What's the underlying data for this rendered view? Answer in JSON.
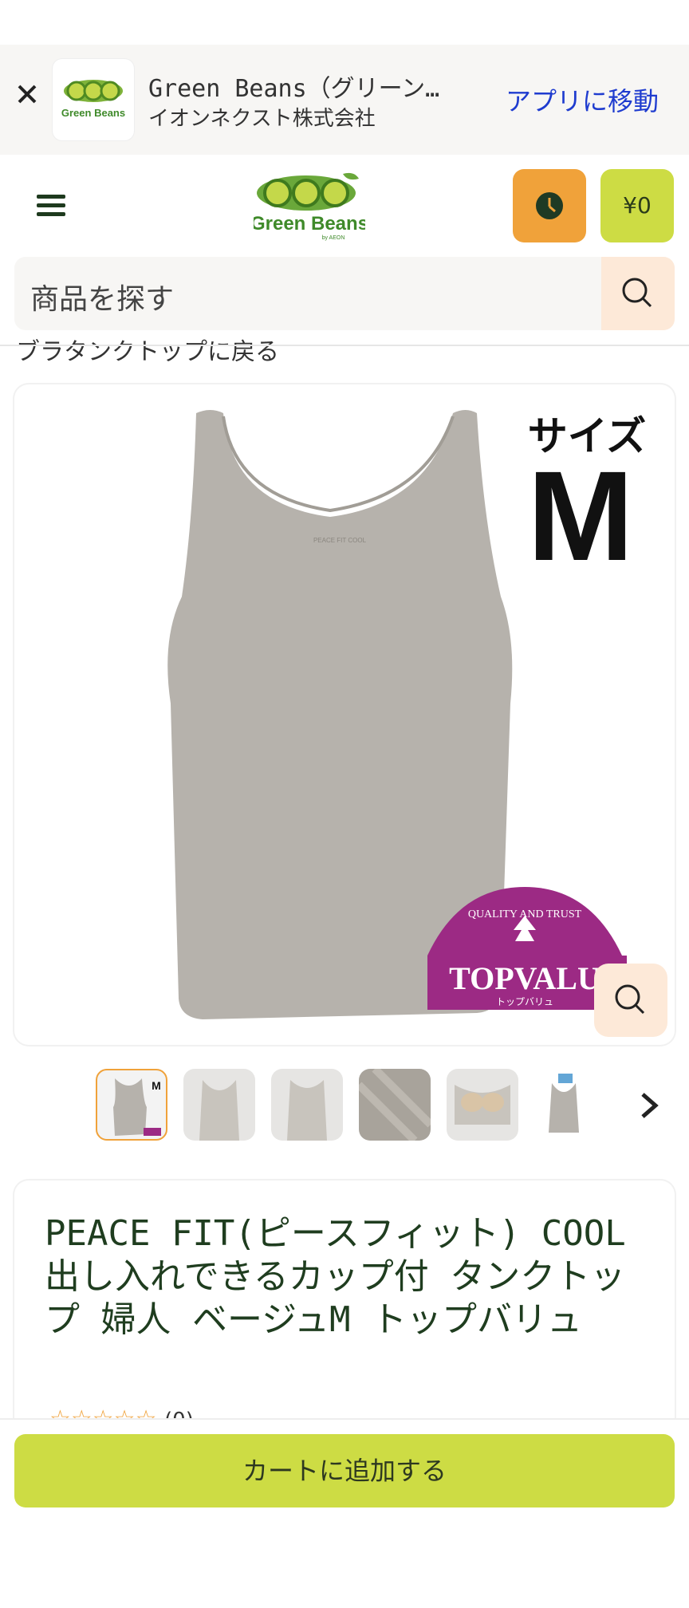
{
  "app_banner": {
    "title": "Green Beans（グリーン…",
    "company": "イオンネクスト株式会社",
    "open_app_label": "アプリに移動",
    "logo_text": "Green Beans"
  },
  "header": {
    "brand_name": "Green Beans",
    "brand_sub": "by AEON",
    "cart_amount": "¥0"
  },
  "search": {
    "placeholder": "商品を探す"
  },
  "breadcrumb": {
    "back_label": "ブラタンクトップに戻る"
  },
  "product_image": {
    "size_label": "サイズ",
    "size_value": "M",
    "seal_text": "QUALITY AND TRUST",
    "brand_text": "TOPVALU",
    "brand_sub": "トップバリュ",
    "garment_print": "PEACE FIT COOL"
  },
  "thumbnails": [
    {
      "name": "front-size"
    },
    {
      "name": "model-front"
    },
    {
      "name": "model-back"
    },
    {
      "name": "fabric"
    },
    {
      "name": "cup-inside"
    },
    {
      "name": "tag"
    }
  ],
  "product": {
    "title": "PEACE FIT(ピースフィット) COOL 出し入れできるカップ付 タンクトップ 婦人 ベージュM トップバリュ",
    "rating_stars": "☆☆☆☆☆",
    "rating_count": "(0)"
  },
  "actions": {
    "add_to_cart": "カートに追加する"
  },
  "colors": {
    "accent": "#cddc44",
    "history_button": "#f0a23a",
    "search_button": "#fde9d8",
    "link": "#1f3ccf"
  }
}
